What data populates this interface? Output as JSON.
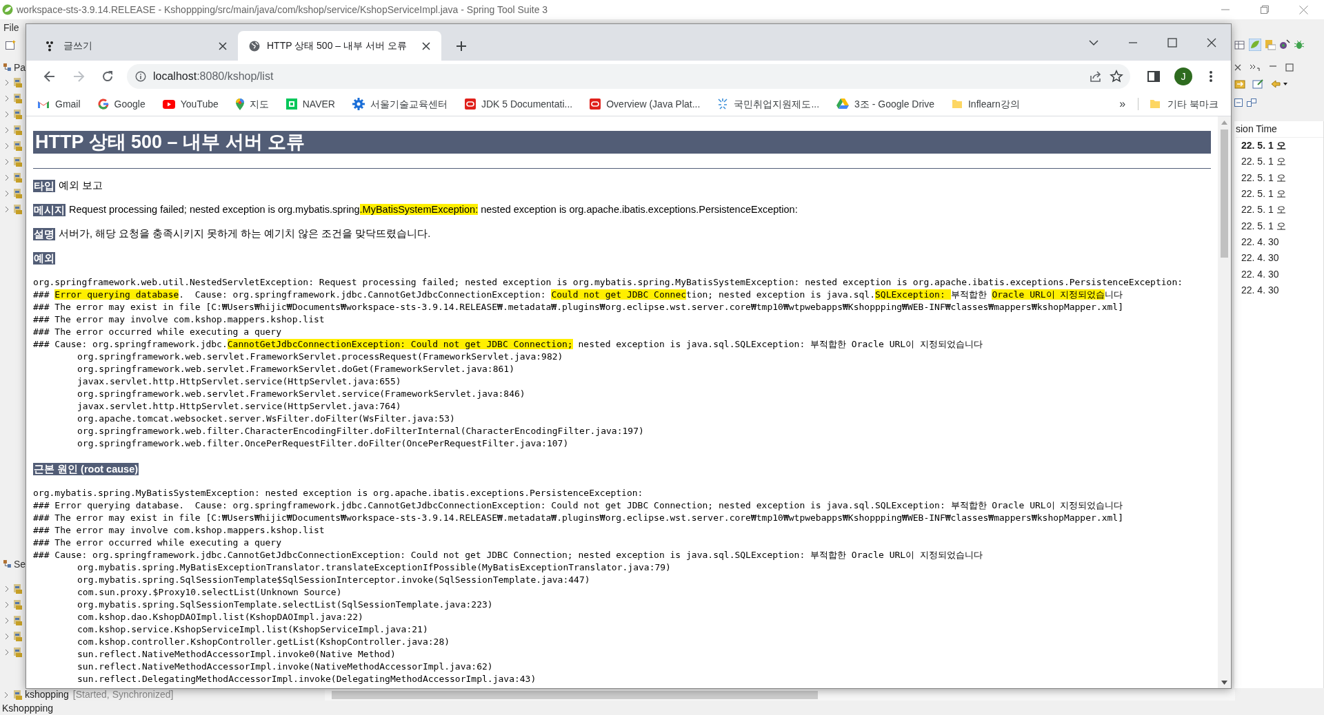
{
  "ide": {
    "title": "workspace-sts-3.9.14.RELEASE - Kshoppping/src/main/java/com/kshop/service/KshopServiceImpl.java - Spring Tool Suite 3",
    "menu": [
      "File"
    ],
    "left_views": [
      "Pa",
      "Se"
    ],
    "right_view": {
      "column": "sion Time",
      "rows": [
        {
          "text": "22. 5. 1 오",
          "bold": true
        },
        {
          "text": "22. 5. 1 오",
          "bold": false
        },
        {
          "text": "22. 5. 1 오",
          "bold": false
        },
        {
          "text": "22. 5. 1 오",
          "bold": false
        },
        {
          "text": "22. 5. 1 오",
          "bold": false
        },
        {
          "text": "22. 5. 1 오",
          "bold": false
        },
        {
          "text": "22. 4. 30",
          "bold": false
        },
        {
          "text": "22. 4. 30",
          "bold": false
        },
        {
          "text": "22. 4. 30",
          "bold": false
        },
        {
          "text": "22. 4. 30",
          "bold": false
        }
      ]
    },
    "server": {
      "name": "kshopping",
      "state": "[Started, Synchronized]"
    },
    "status": "Kshoppping"
  },
  "browser": {
    "tabs": [
      {
        "label": "글쓰기",
        "selected": false,
        "kind": "dots"
      },
      {
        "label": "HTTP 상태 500 – 내부 서버 오류",
        "selected": true,
        "kind": "globe"
      }
    ],
    "address": {
      "host": "localhost",
      "path": ":8080/kshop/list"
    },
    "avatar": "J",
    "bookmarks": [
      {
        "label": "Gmail",
        "kind": "gmail"
      },
      {
        "label": "Google",
        "kind": "google"
      },
      {
        "label": "YouTube",
        "kind": "youtube"
      },
      {
        "label": "지도",
        "kind": "maps"
      },
      {
        "label": "NAVER",
        "kind": "naver"
      },
      {
        "label": "서울기술교육센터",
        "kind": "gear"
      },
      {
        "label": "JDK 5 Documentati...",
        "kind": "oracle"
      },
      {
        "label": "Overview (Java Plat...",
        "kind": "oracle"
      },
      {
        "label": "국민취업지원제도...",
        "kind": "spark"
      },
      {
        "label": "3조 - Google Drive",
        "kind": "drive"
      },
      {
        "label": "Inflearn강의",
        "kind": "folder"
      }
    ],
    "overflow": "»",
    "other_bookmarks": "기타 북마크"
  },
  "page": {
    "heading": "HTTP 상태 500 – 내부 서버 오류",
    "fields": [
      {
        "label": "타입",
        "segments": [
          {
            "text": "예외 보고",
            "highlighted": false
          }
        ]
      },
      {
        "label": "메시지",
        "segments": [
          {
            "text": "Request processing failed; nested exception is org.mybatis.spring",
            "highlighted": false
          },
          {
            "text": ".MyBatisSystemException:",
            "highlighted": true
          },
          {
            "text": " nested exception is org.apache.ibatis.exceptions.PersistenceException:",
            "highlighted": false
          }
        ]
      },
      {
        "label": "설명",
        "segments": [
          {
            "text": "서버가, 해당 요청을 충족시키지 못하게 하는 예기치 않은 조건을 맞닥뜨렸습니다.",
            "highlighted": false
          }
        ]
      }
    ],
    "sections": [
      {
        "label": "예외",
        "lines": [
          {
            "kind": "message",
            "text": "org.springframework.web.util.NestedServletException: Request processing failed; nested exception is org.mybatis.spring.MyBatisSystemException: nested exception is org.apache.ibatis.exceptions.PersistenceException:"
          },
          {
            "kind": "message",
            "segments": [
              {
                "text": "### ",
                "highlighted": false
              },
              {
                "text": "Error querying database",
                "highlighted": true
              },
              {
                "text": ".  Cause: org.springframework.jdbc.CannotGetJdbcConnectionException: ",
                "highlighted": false
              },
              {
                "text": "Could not get JDBC Connec",
                "highlighted": true
              },
              {
                "text": "tion; nested exception is java.sql.",
                "highlighted": false
              },
              {
                "text": "SQLException: ",
                "highlighted": true
              },
              {
                "text": "부적합한 ",
                "highlighted": false
              },
              {
                "text": "Oracle URL이 지정되었습",
                "highlighted": true
              },
              {
                "text": "니다",
                "highlighted": false
              }
            ]
          },
          {
            "kind": "message",
            "text": "### The error may exist in file [C:₩Users₩hijic₩Documents₩workspace-sts-3.9.14.RELEASE₩.metadata₩.plugins₩org.eclipse.wst.server.core₩tmp10₩wtpwebapps₩Kshoppping₩WEB-INF₩classes₩mappers₩kshopMapper.xml]"
          },
          {
            "kind": "message",
            "text": "### The error may involve com.kshop.mappers.kshop.list"
          },
          {
            "kind": "message",
            "text": "### The error occurred while executing a query"
          },
          {
            "kind": "message",
            "segments": [
              {
                "text": "### Cause: org.springframework.jdbc.",
                "highlighted": false
              },
              {
                "text": "CannotGetJdbcConnectionException: Could not get JDBC Connection;",
                "highlighted": true
              },
              {
                "text": " nested exception is java.sql.SQLException: 부적합한 Oracle URL이 지정되었습니다",
                "highlighted": false
              }
            ]
          },
          {
            "kind": "frame",
            "text": "org.springframework.web.servlet.FrameworkServlet.processRequest(FrameworkServlet.java:982)"
          },
          {
            "kind": "frame",
            "text": "org.springframework.web.servlet.FrameworkServlet.doGet(FrameworkServlet.java:861)"
          },
          {
            "kind": "frame",
            "text": "javax.servlet.http.HttpServlet.service(HttpServlet.java:655)"
          },
          {
            "kind": "frame",
            "text": "org.springframework.web.servlet.FrameworkServlet.service(FrameworkServlet.java:846)"
          },
          {
            "kind": "frame",
            "text": "javax.servlet.http.HttpServlet.service(HttpServlet.java:764)"
          },
          {
            "kind": "frame",
            "text": "org.apache.tomcat.websocket.server.WsFilter.doFilter(WsFilter.java:53)"
          },
          {
            "kind": "frame",
            "text": "org.springframework.web.filter.CharacterEncodingFilter.doFilterInternal(CharacterEncodingFilter.java:197)"
          },
          {
            "kind": "frame",
            "text": "org.springframework.web.filter.OncePerRequestFilter.doFilter(OncePerRequestFilter.java:107)"
          }
        ]
      },
      {
        "label": "근본 원인 (root cause)",
        "lines": [
          {
            "kind": "message",
            "text": "org.mybatis.spring.MyBatisSystemException: nested exception is org.apache.ibatis.exceptions.PersistenceException:"
          },
          {
            "kind": "message",
            "text": "### Error querying database.  Cause: org.springframework.jdbc.CannotGetJdbcConnectionException: Could not get JDBC Connection; nested exception is java.sql.SQLException: 부적합한 Oracle URL이 지정되었습니다"
          },
          {
            "kind": "message",
            "text": "### The error may exist in file [C:₩Users₩hijic₩Documents₩workspace-sts-3.9.14.RELEASE₩.metadata₩.plugins₩org.eclipse.wst.server.core₩tmp10₩wtpwebapps₩Kshoppping₩WEB-INF₩classes₩mappers₩kshopMapper.xml]"
          },
          {
            "kind": "message",
            "text": "### The error may involve com.kshop.mappers.kshop.list"
          },
          {
            "kind": "message",
            "text": "### The error occurred while executing a query"
          },
          {
            "kind": "message",
            "text": "### Cause: org.springframework.jdbc.CannotGetJdbcConnectionException: Could not get JDBC Connection; nested exception is java.sql.SQLException: 부적합한 Oracle URL이 지정되었습니다"
          },
          {
            "kind": "frame",
            "text": "org.mybatis.spring.MyBatisExceptionTranslator.translateExceptionIfPossible(MyBatisExceptionTranslator.java:79)"
          },
          {
            "kind": "frame",
            "text": "org.mybatis.spring.SqlSessionTemplate$SqlSessionInterceptor.invoke(SqlSessionTemplate.java:447)"
          },
          {
            "kind": "frame",
            "text": "com.sun.proxy.$Proxy10.selectList(Unknown Source)"
          },
          {
            "kind": "frame",
            "text": "org.mybatis.spring.SqlSessionTemplate.selectList(SqlSessionTemplate.java:223)"
          },
          {
            "kind": "frame",
            "text": "com.kshop.dao.KshopDAOImpl.list(KshopDAOImpl.java:22)"
          },
          {
            "kind": "frame",
            "text": "com.kshop.service.KshopServiceImpl.list(KshopServiceImpl.java:21)"
          },
          {
            "kind": "frame",
            "text": "com.kshop.controller.KshopController.getList(KshopController.java:28)"
          },
          {
            "kind": "frame",
            "text": "sun.reflect.NativeMethodAccessorImpl.invoke0(Native Method)"
          },
          {
            "kind": "frame",
            "text": "sun.reflect.NativeMethodAccessorImpl.invoke(NativeMethodAccessorImpl.java:62)"
          },
          {
            "kind": "frame",
            "text": "sun.reflect.DelegatingMethodAccessorImpl.invoke(DelegatingMethodAccessorImpl.java:43)"
          }
        ]
      }
    ]
  }
}
